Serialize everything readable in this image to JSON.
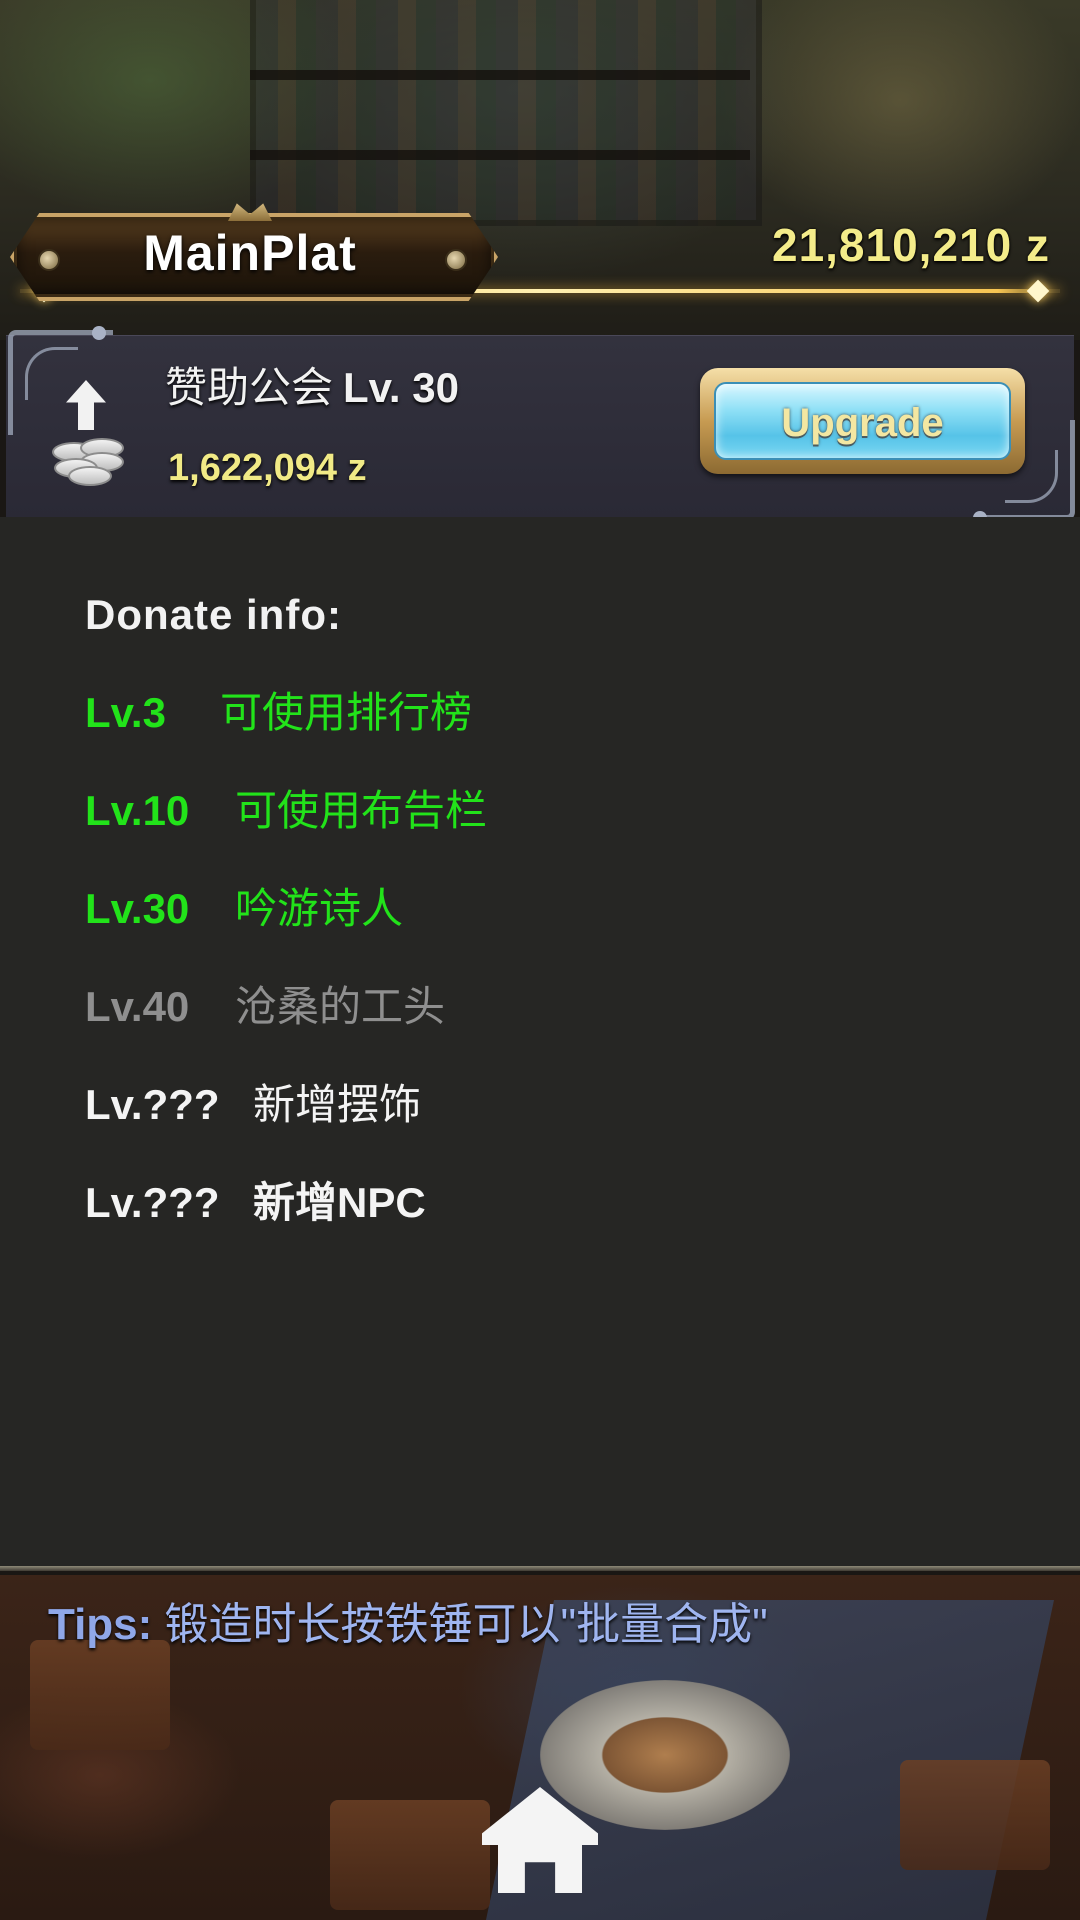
{
  "header": {
    "title": "MainPlat",
    "gold_total": "21,810,210 z"
  },
  "guild": {
    "name": "赞助公会",
    "level": "Lv. 30",
    "cost": "1,622,094 z",
    "upgrade_label": "Upgrade"
  },
  "donate": {
    "title": "Donate info:",
    "rows": [
      {
        "level": "Lv.3",
        "text": "可使用排行榜",
        "state": "unlocked"
      },
      {
        "level": "Lv.10",
        "text": "可使用布告栏",
        "state": "unlocked"
      },
      {
        "level": "Lv.30",
        "text": "吟游诗人",
        "state": "unlocked"
      },
      {
        "level": "Lv.40",
        "text": "沧桑的工头",
        "state": "locked"
      },
      {
        "level": "Lv.???",
        "text": "新增摆饰",
        "state": "unknown"
      },
      {
        "level": "Lv.???",
        "text": "新增NPC",
        "state": "unknown"
      }
    ]
  },
  "tips": {
    "label": "Tips:",
    "text": "锻造时长按铁锤可以\"批量合成\""
  },
  "icons": {
    "coins": "coin-stack-upgrade-icon",
    "home": "home-icon"
  },
  "colors": {
    "unlocked": "#22e31a",
    "locked": "#8f8f8f",
    "unknown": "#f4f4f4",
    "gold": "#f4ec8a",
    "tips": "#8fa7e8"
  }
}
